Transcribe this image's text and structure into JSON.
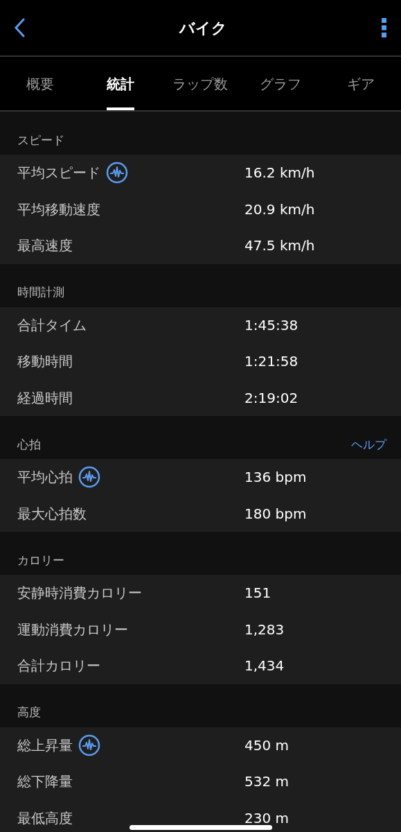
{
  "header": {
    "title": "バイク"
  },
  "tabs": [
    {
      "label": "概要",
      "selected": false
    },
    {
      "label": "統計",
      "selected": true
    },
    {
      "label": "ラップ数",
      "selected": false
    },
    {
      "label": "グラフ",
      "selected": false
    },
    {
      "label": "ギア",
      "selected": false
    }
  ],
  "sections": [
    {
      "title": "スピード",
      "rows": [
        {
          "label": "平均スピード",
          "value": "16.2 km/h",
          "chart_badge": true
        },
        {
          "label": "平均移動速度",
          "value": "20.9 km/h",
          "chart_badge": false
        },
        {
          "label": "最高速度",
          "value": "47.5 km/h",
          "chart_badge": false
        }
      ]
    },
    {
      "title": "時間計測",
      "rows": [
        {
          "label": "合計タイム",
          "value": "1:45:38",
          "chart_badge": false
        },
        {
          "label": "移動時間",
          "value": "1:21:58",
          "chart_badge": false
        },
        {
          "label": "経過時間",
          "value": "2:19:02",
          "chart_badge": false
        }
      ]
    },
    {
      "title": "心拍",
      "link": "ヘルプ",
      "rows": [
        {
          "label": "平均心拍",
          "value": "136 bpm",
          "chart_badge": true
        },
        {
          "label": "最大心拍数",
          "value": "180 bpm",
          "chart_badge": false
        }
      ]
    },
    {
      "title": "カロリー",
      "rows": [
        {
          "label": "安静時消費カロリー",
          "value": "151",
          "chart_badge": false
        },
        {
          "label": "運動消費カロリー",
          "value": "1,283",
          "chart_badge": false
        },
        {
          "label": "合計カロリー",
          "value": "1,434",
          "chart_badge": false
        }
      ]
    },
    {
      "title": "高度",
      "rows": [
        {
          "label": "総上昇量",
          "value": "450 m",
          "chart_badge": true
        },
        {
          "label": "総下降量",
          "value": "532 m",
          "chart_badge": false
        },
        {
          "label": "最低高度",
          "value": "230 m",
          "chart_badge": false
        }
      ]
    }
  ]
}
